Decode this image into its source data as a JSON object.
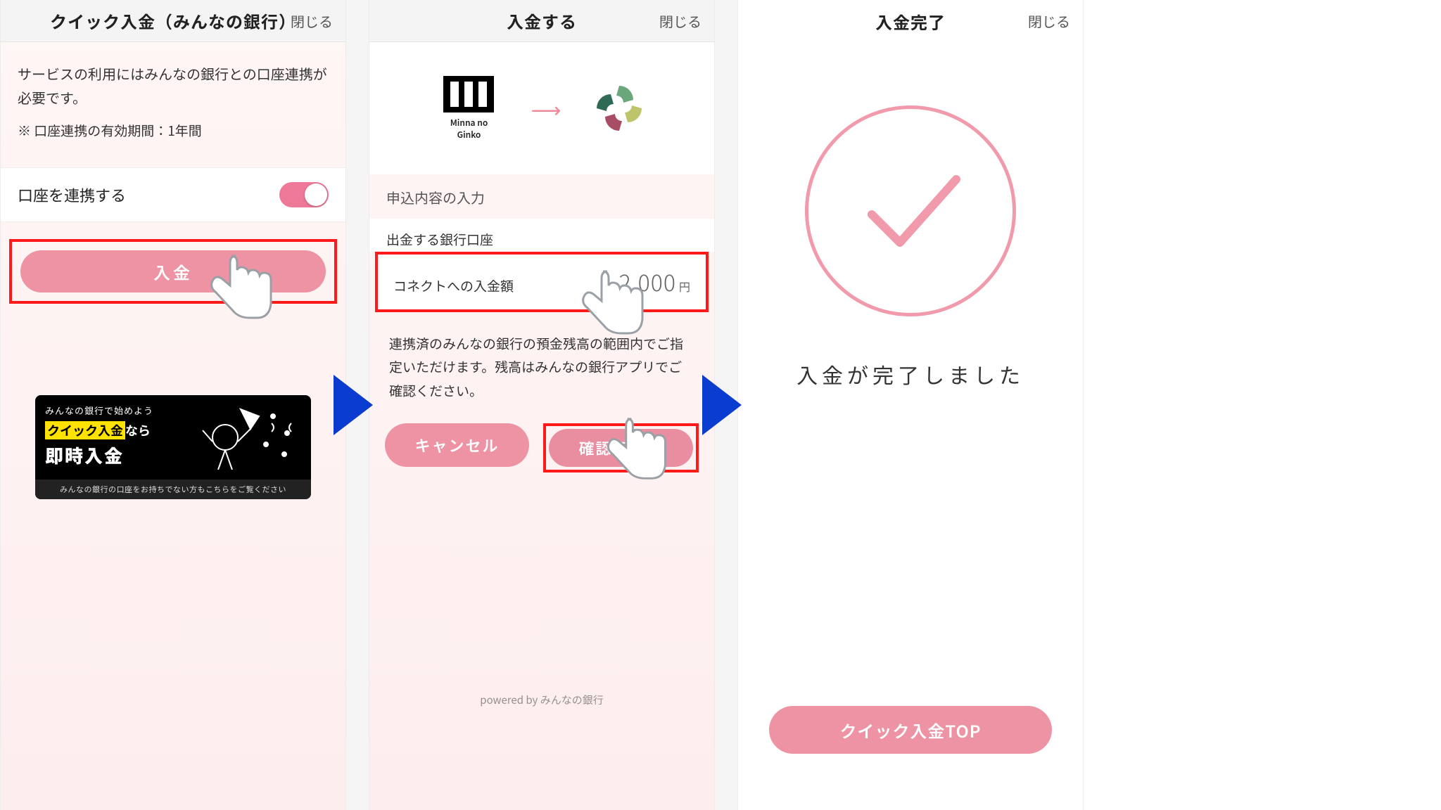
{
  "common": {
    "close_label": "閉じる"
  },
  "screen1": {
    "title": "クイック入金（みんなの銀行）",
    "desc": "サービスの利用にはみんなの銀行との口座連携が必要です。",
    "note": "※ 口座連携の有効期間：1年間",
    "link_label": "口座を連携する",
    "deposit_button": "入金",
    "banner": {
      "line1": "みんなの銀行で始めよう",
      "line2_hl": "クイック入金",
      "line2_rest": "なら",
      "line3": "即時入金",
      "foot": "みんなの銀行の口座をお持ちでない方もこちらをご覧ください"
    }
  },
  "screen2": {
    "title": "入金する",
    "minna_caption": "Minna no Ginko",
    "section_label": "申込内容の入力",
    "account_label": "出金する銀行口座",
    "amount_label": "コネクトへの入金額",
    "amount_value": "2,000",
    "amount_unit": "円",
    "desc": "連携済のみんなの銀行の預金残高の範囲内でご指定いただけます。残高はみんなの銀行アプリでご確認ください。",
    "cancel_button": "キャンセル",
    "confirm_button": "確認画面へ",
    "powered": "powered by みんなの銀行"
  },
  "screen3": {
    "title": "入金完了",
    "message": "入金が完了しました",
    "top_button": "クイック入金TOP"
  }
}
